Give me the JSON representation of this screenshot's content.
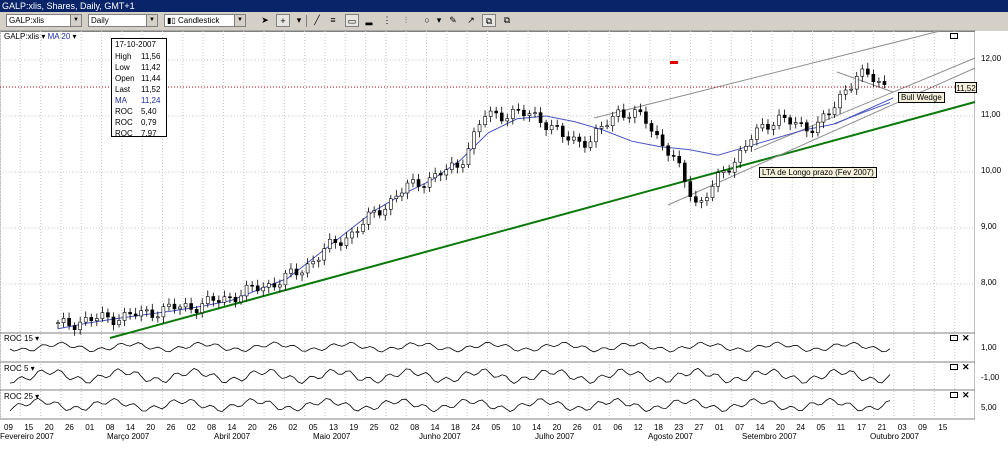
{
  "window": {
    "title": "GALP:xlis, Shares, Daily, GMT+1"
  },
  "toolbar": {
    "symbol": "GALP:xlis",
    "period": "Daily",
    "chart_style": "Candlestick",
    "icons": [
      "cursor-icon",
      "crosshair-icon",
      "zoom-icon",
      "trendline-icon",
      "channel-icon",
      "bar-icon",
      "histogram-icon",
      "cycle-icon",
      "circle-icon",
      "pencil-icon",
      "tool-icon",
      "tool2-icon"
    ]
  },
  "panels": {
    "main": {
      "symbol_label": "GALP:xlis",
      "indicator_label": "MA 20"
    },
    "roc1": {
      "label": "ROC 15",
      "tick": "1,00"
    },
    "roc2": {
      "label": "ROC 5",
      "tick": "-1,00"
    },
    "roc3": {
      "label": "ROC 25",
      "tick": "5,00"
    }
  },
  "infobox": {
    "date": "17-10-2007",
    "rows": [
      {
        "k": "High",
        "v": "11,56"
      },
      {
        "k": "Low",
        "v": "11,42"
      },
      {
        "k": "Open",
        "v": "11,44"
      },
      {
        "k": "Last",
        "v": "11,52"
      },
      {
        "k": "MA",
        "v": "11,24"
      },
      {
        "k": "ROC",
        "v": "5,40"
      },
      {
        "k": "ROC",
        "v": "0,79"
      },
      {
        "k": "ROC",
        "v": "7,97"
      }
    ]
  },
  "last_price_label": "11,52",
  "annotations": {
    "bull_wedge": "Bull Wedge",
    "lta": "LTA de Longo prazo (Fev 2007)"
  },
  "colors": {
    "long_trend": "#0a7a0a",
    "ma_line": "#4a55c0",
    "price_line": "#c00000",
    "candle": "#000000",
    "titlebar": "#0a246a"
  },
  "chart_data": {
    "type": "candlestick",
    "y_ticks": [
      "12,00",
      "11,00",
      "10,00",
      "9,00",
      "8,00"
    ],
    "ylim": [
      7.2,
      12.5
    ],
    "date_ticks": [
      "09",
      "15",
      "20",
      "26",
      "01",
      "08",
      "14",
      "20",
      "26",
      "02",
      "08",
      "14",
      "20",
      "26",
      "02",
      "05",
      "13",
      "19",
      "25",
      "02",
      "08",
      "14",
      "18",
      "24",
      "05",
      "10",
      "14",
      "20",
      "26",
      "01",
      "06",
      "12",
      "18",
      "23",
      "27",
      "01",
      "07",
      "14",
      "20",
      "24",
      "05",
      "11",
      "17",
      "21",
      "03",
      "09",
      "15"
    ],
    "months": [
      "Fevereiro 2007",
      "Março 2007",
      "Abril 2007",
      "Maio 2007",
      "Junho 2007",
      "Julho 2007",
      "Agosto 2007",
      "Setembro 2007",
      "Outubro 2007"
    ],
    "close_series_approx": [
      7.25,
      7.35,
      7.4,
      7.45,
      7.55,
      7.6,
      7.7,
      7.85,
      8.0,
      8.2,
      8.6,
      8.9,
      9.3,
      9.7,
      9.9,
      10.1,
      11.0,
      11.05,
      11.0,
      10.6,
      10.55,
      11.1,
      10.95,
      10.3,
      9.4,
      10.0,
      10.6,
      11.0,
      10.75,
      11.05,
      11.8,
      11.52
    ],
    "ma20_approx": [
      7.2,
      7.3,
      7.38,
      7.45,
      7.52,
      7.6,
      7.7,
      7.9,
      8.1,
      8.5,
      8.9,
      9.3,
      9.6,
      9.85,
      10.2,
      10.7,
      10.95,
      11.0,
      10.9,
      10.75,
      10.55,
      10.45,
      10.4,
      10.3,
      10.45,
      10.6,
      10.75,
      10.85,
      11.05,
      11.24
    ],
    "roc_ticks": {
      "roc15": "1,00",
      "roc5": "-1,00",
      "roc25": "5,00"
    },
    "title": "",
    "xlabel": "",
    "ylabel": ""
  }
}
